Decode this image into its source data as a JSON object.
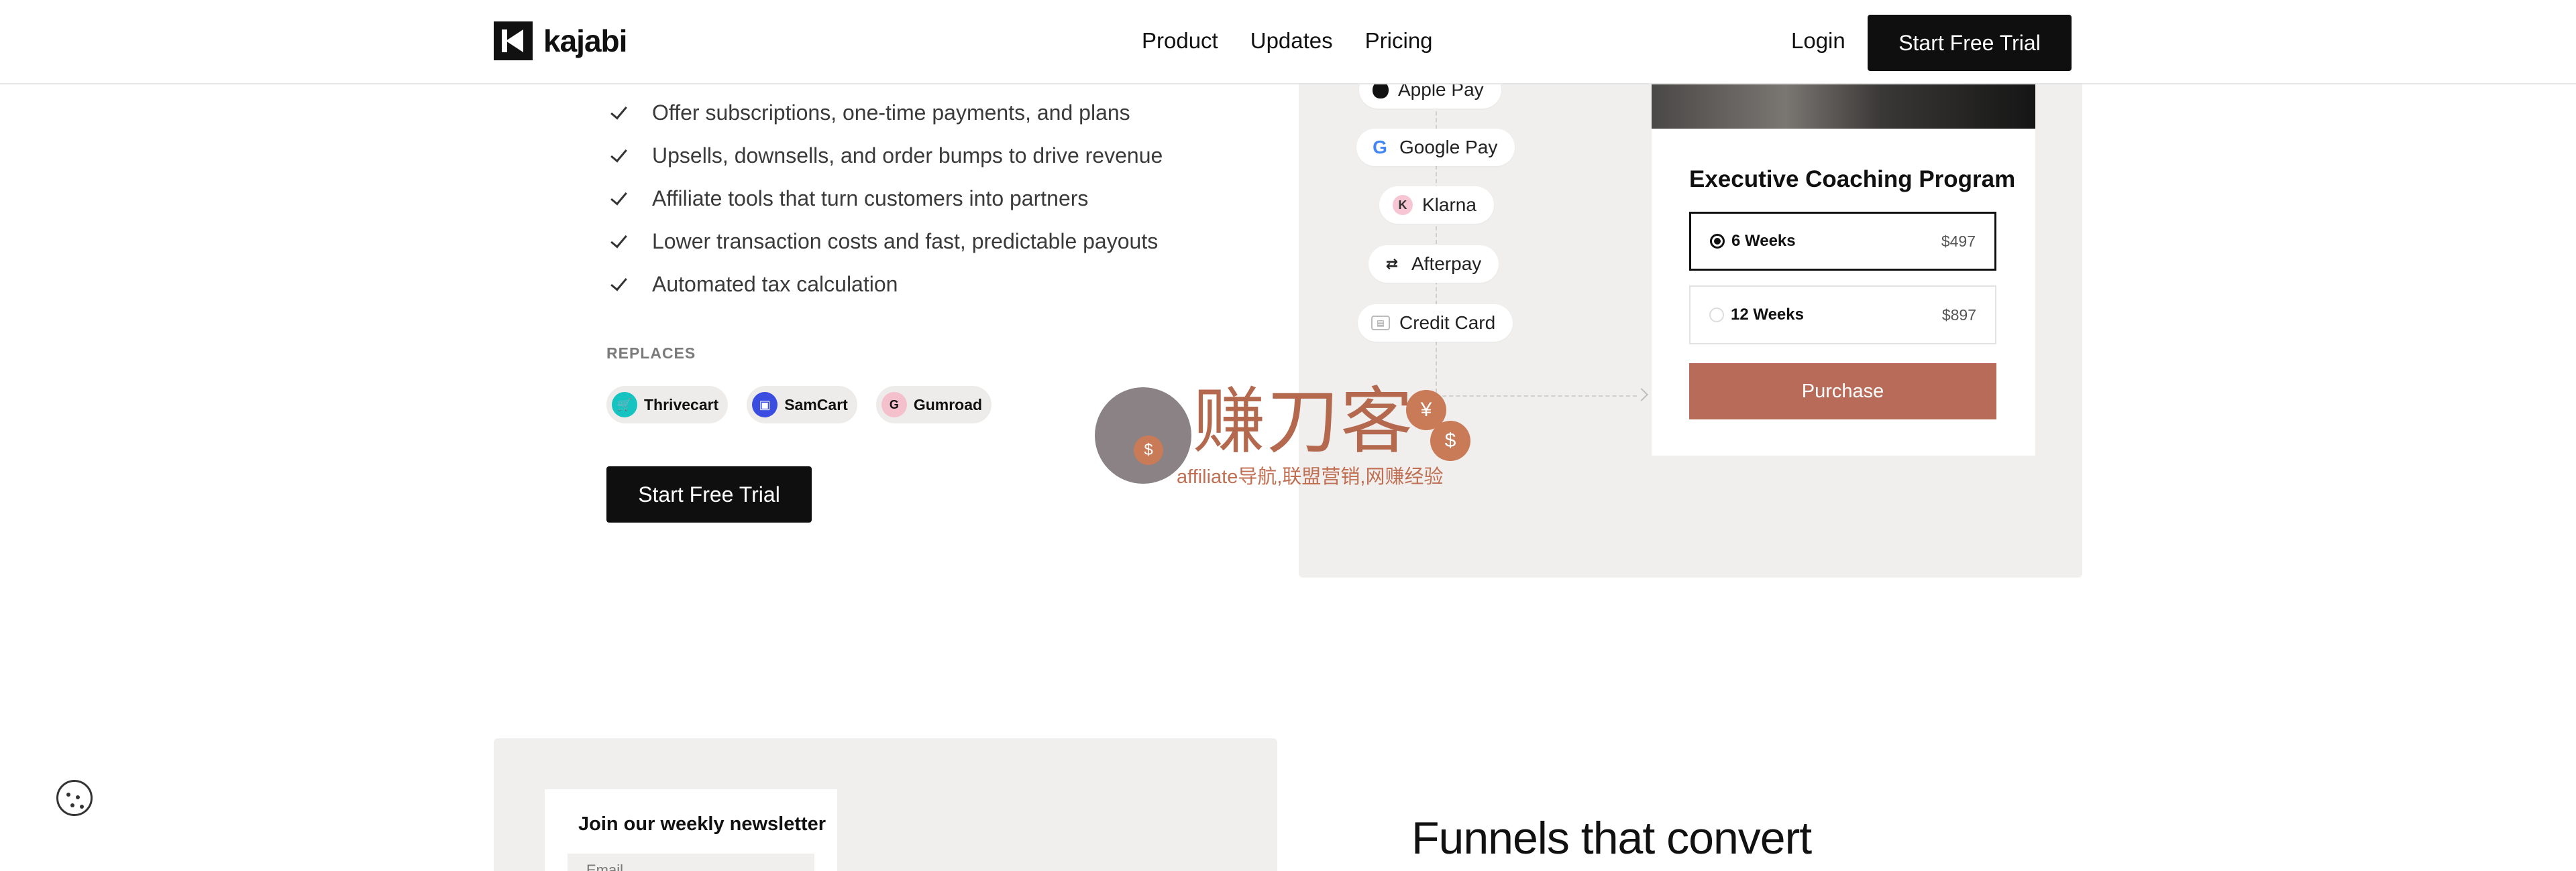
{
  "header": {
    "logo_text": "kajabi",
    "nav": [
      "Product",
      "Updates",
      "Pricing"
    ],
    "login_label": "Login",
    "cta_label": "Start Free Trial"
  },
  "features": [
    "Offer subscriptions, one-time payments, and plans",
    "Upsells, downsells, and order bumps to drive revenue",
    "Affiliate tools that turn customers into partners",
    "Lower transaction costs and fast, predictable payouts",
    "Automated tax calculation"
  ],
  "replaces": {
    "label": "REPLACES",
    "items": [
      {
        "name": "Thrivecart",
        "icon": "thrivecart-icon",
        "glyph": "🛒"
      },
      {
        "name": "SamCart",
        "icon": "samcart-icon",
        "glyph": "▣"
      },
      {
        "name": "Gumroad",
        "icon": "gumroad-icon",
        "glyph": "G"
      }
    ]
  },
  "main_cta_label": "Start Free Trial",
  "payment_methods": [
    {
      "label": "Apple Pay",
      "icon": "apple-icon"
    },
    {
      "label": "Google Pay",
      "icon": "google-icon",
      "glyph": "G"
    },
    {
      "label": "Klarna",
      "icon": "klarna-icon",
      "glyph": "K"
    },
    {
      "label": "Afterpay",
      "icon": "afterpay-icon",
      "glyph": "⇄"
    },
    {
      "label": "Credit Card",
      "icon": "credit-card-icon",
      "glyph": "▤"
    }
  ],
  "checkout": {
    "title": "Executive Coaching Program",
    "options": [
      {
        "label": "6 Weeks",
        "price": "$497",
        "selected": true
      },
      {
        "label": "12 Weeks",
        "price": "$897",
        "selected": false
      }
    ],
    "purchase_label": "Purchase"
  },
  "watermark": {
    "title": "赚刀客",
    "subtitle": "affiliate导航,联盟营销,网赚经验"
  },
  "newsletter": {
    "title": "Join our weekly newsletter",
    "email_placeholder": "Email"
  },
  "funnels_heading": "Funnels that convert",
  "colors": {
    "accent": "#b86b59",
    "panel_bg": "#f0efed",
    "dark": "#0f0f0f"
  }
}
